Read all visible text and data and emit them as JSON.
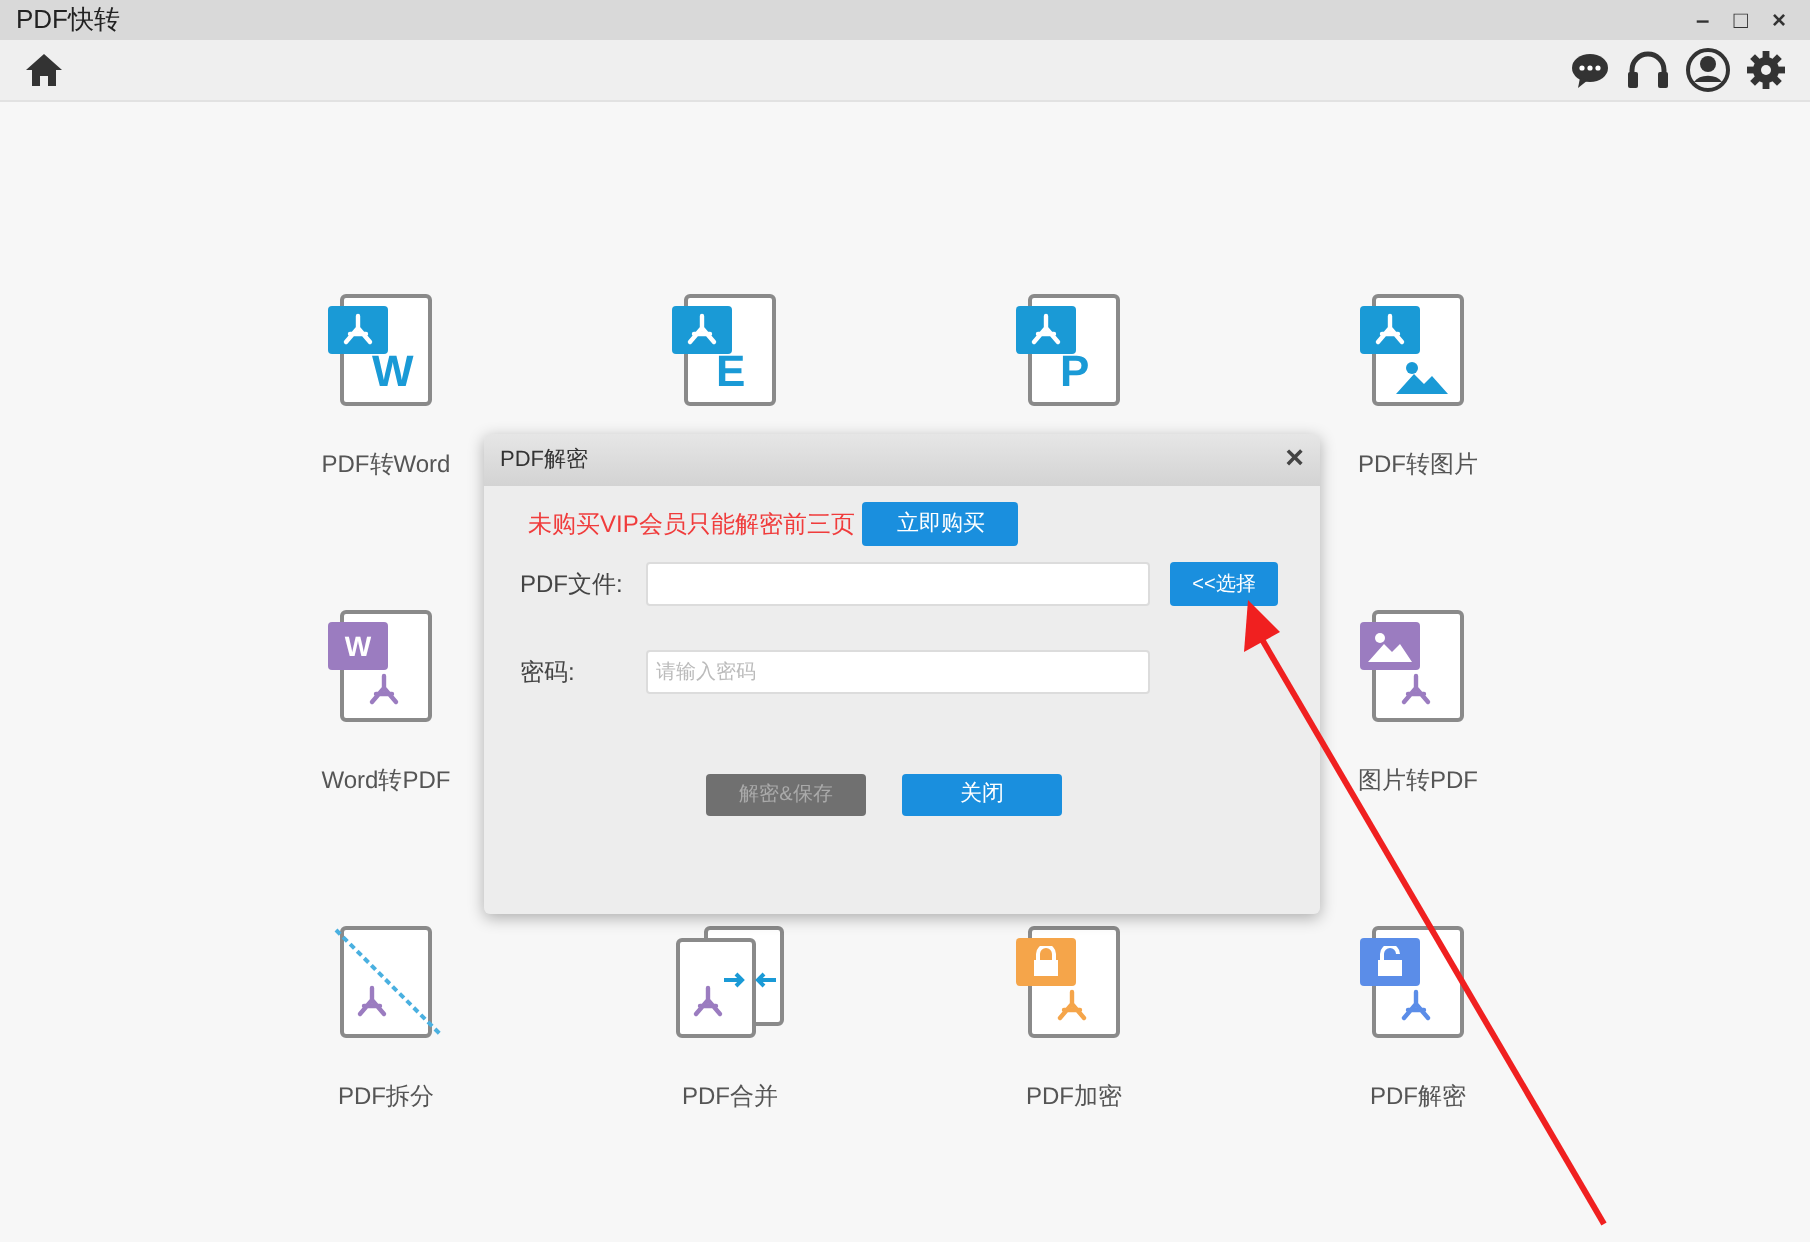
{
  "window": {
    "title": "PDF快转",
    "controls": [
      "–",
      "□",
      "×"
    ]
  },
  "tiles": [
    {
      "kind": "doc",
      "glyph": "W",
      "label": "PDF转Word"
    },
    {
      "kind": "doc",
      "glyph": "E"
    },
    {
      "kind": "doc",
      "glyph": "P"
    },
    {
      "kind": "image",
      "label": "PDF转图片"
    },
    {
      "kind": "to-pdf",
      "glyph": "W",
      "label": "Word转PDF"
    },
    {
      "kind": "hidden"
    },
    {
      "kind": "hidden"
    },
    {
      "kind": "image-to-pdf",
      "label": "图片转PDF"
    },
    {
      "kind": "split",
      "label": "PDF拆分"
    },
    {
      "kind": "merge",
      "label": "PDF合并"
    },
    {
      "kind": "lock",
      "label": "PDF加密"
    },
    {
      "kind": "unlock",
      "label": "PDF解密"
    }
  ],
  "dialog": {
    "title": "PDF解密",
    "close": "×",
    "notice": "未购买VIP会员只能解密前三页",
    "buy_button": "立即购买",
    "file_label": "PDF文件:",
    "choose_button": "<<选择",
    "password_label": "密码:",
    "password_placeholder": "请输入密码",
    "buttons": [
      {
        "label": "解密&保存",
        "disabled": true
      },
      {
        "label": "关闭",
        "disabled": false
      }
    ]
  }
}
